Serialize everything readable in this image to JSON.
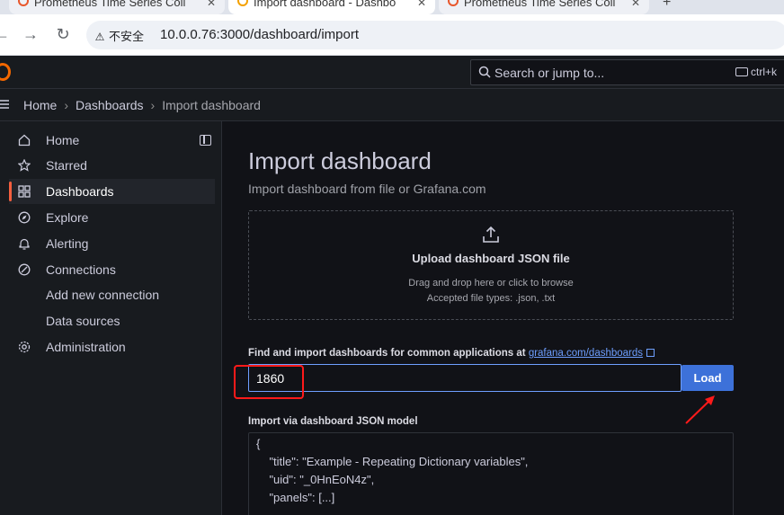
{
  "browser": {
    "tabs": [
      {
        "title": "Prometheus Time Series Coll"
      },
      {
        "title": "Import dashboard - Dashbo"
      },
      {
        "title": "Prometheus Time Series Coll"
      }
    ],
    "security_label": "不安全",
    "url": "10.0.0.76:3000/dashboard/import"
  },
  "topbar": {
    "search_placeholder": "Search or jump to...",
    "shortcut": "ctrl+k"
  },
  "breadcrumbs": [
    "Home",
    "Dashboards",
    "Import dashboard"
  ],
  "sidebar": {
    "items": [
      {
        "label": "Home",
        "icon": "home-icon"
      },
      {
        "label": "Starred",
        "icon": "star-icon"
      },
      {
        "label": "Dashboards",
        "icon": "apps-icon",
        "active": true
      },
      {
        "label": "Explore",
        "icon": "compass-icon"
      },
      {
        "label": "Alerting",
        "icon": "bell-icon"
      },
      {
        "label": "Connections",
        "icon": "link-icon"
      },
      {
        "label": "Add new connection",
        "icon": ""
      },
      {
        "label": "Data sources",
        "icon": ""
      },
      {
        "label": "Administration",
        "icon": "cog-icon"
      }
    ]
  },
  "page": {
    "title": "Import dashboard",
    "subtitle": "Import dashboard from file or Grafana.com",
    "upload": {
      "title": "Upload dashboard JSON file",
      "hint1": "Drag and drop here or click to browse",
      "hint2": "Accepted file types: .json, .txt"
    },
    "find_label": "Find and import dashboards for common applications at",
    "find_link": "grafana.com/dashboards",
    "dashboard_id_value": "1860",
    "load_label": "Load",
    "json_label": "Import via dashboard JSON model",
    "json_lines": [
      "{",
      "    \"title\": \"Example - Repeating Dictionary variables\",",
      "    \"uid\": \"_0HnEoN4z\",",
      "    \"panels\": [...]"
    ]
  },
  "colors": {
    "accent": "#3d71d9",
    "annotation": "#ff1a1a",
    "active_bar": "#f55f3e"
  }
}
